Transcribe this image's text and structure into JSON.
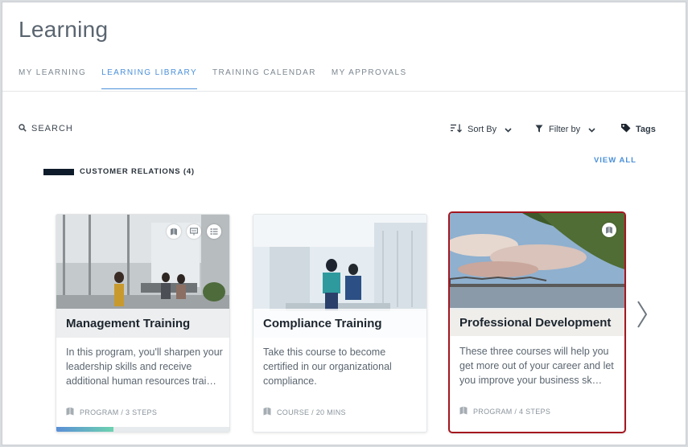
{
  "page": {
    "title": "Learning"
  },
  "tabs": [
    {
      "label": "MY LEARNING",
      "active": false
    },
    {
      "label": "LEARNING LIBRARY",
      "active": true
    },
    {
      "label": "TRAINING CALENDAR",
      "active": false
    },
    {
      "label": "MY APPROVALS",
      "active": false
    }
  ],
  "toolbar": {
    "search_label": "SEARCH",
    "sort_label": "Sort By",
    "filter_label": "Filter by",
    "tags_label": "Tags"
  },
  "section": {
    "title": "CUSTOMER RELATIONS (4)",
    "view_all": "VIEW ALL"
  },
  "cards": [
    {
      "title": "Management Training",
      "description": "In this program, you'll sharpen your leadership skills and receive additional human resources trai…",
      "meta": "PROGRAM / 3 STEPS",
      "badges": [
        "book-icon",
        "presentation-icon",
        "checklist-icon"
      ],
      "progress": 0.33,
      "selected": false
    },
    {
      "title": "Compliance Training",
      "description": "Take this course to become certified in our organizational compliance.",
      "meta": "COURSE / 20 MINS",
      "badges": [],
      "progress": null,
      "selected": false
    },
    {
      "title": "Professional Development",
      "description": "These three courses will help you get more out of your career and let you improve your business sk…",
      "meta": "PROGRAM / 4 STEPS",
      "badges": [
        "book-icon"
      ],
      "progress": null,
      "selected": true
    }
  ],
  "colors": {
    "accent": "#4a90d9",
    "selected_border": "#a4171f",
    "section_bar": "#0d1b2a"
  }
}
